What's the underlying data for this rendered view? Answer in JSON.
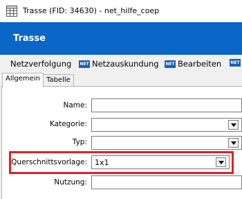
{
  "window": {
    "title": "Trasse (FID: 34630) - net_hilfe_coep",
    "app_icon": "table-icon"
  },
  "header": {
    "title": "Trasse"
  },
  "actions": [
    {
      "label": "Netzverfolgung",
      "icon": null
    },
    {
      "label": "Netzauskundung",
      "icon": "net-icon",
      "icon_text": "NET"
    },
    {
      "label": "Bearbeiten",
      "icon": "net-icon",
      "icon_text": "NET"
    },
    {
      "label": "",
      "icon": "net-icon",
      "icon_text": "NET"
    }
  ],
  "tabs": [
    {
      "label": "Allgemein",
      "active": true
    },
    {
      "label": "Tabelle",
      "active": false
    }
  ],
  "form": {
    "name": {
      "label": "Name:",
      "value": ""
    },
    "kategorie": {
      "label": "Kategorie:",
      "value": ""
    },
    "typ": {
      "label": "Typ:",
      "value": ""
    },
    "querschnittsvorlage": {
      "label": "Querschnittsvorlage:",
      "value": "1x1"
    },
    "nutzung": {
      "label": "Nutzung:",
      "value": ""
    }
  },
  "highlight": {
    "color": "#e02027",
    "target": "querschnittsvorlage"
  },
  "colors": {
    "header_band": "#0a66c7",
    "panel": "#ffffff",
    "background": "#f0f0f0"
  }
}
